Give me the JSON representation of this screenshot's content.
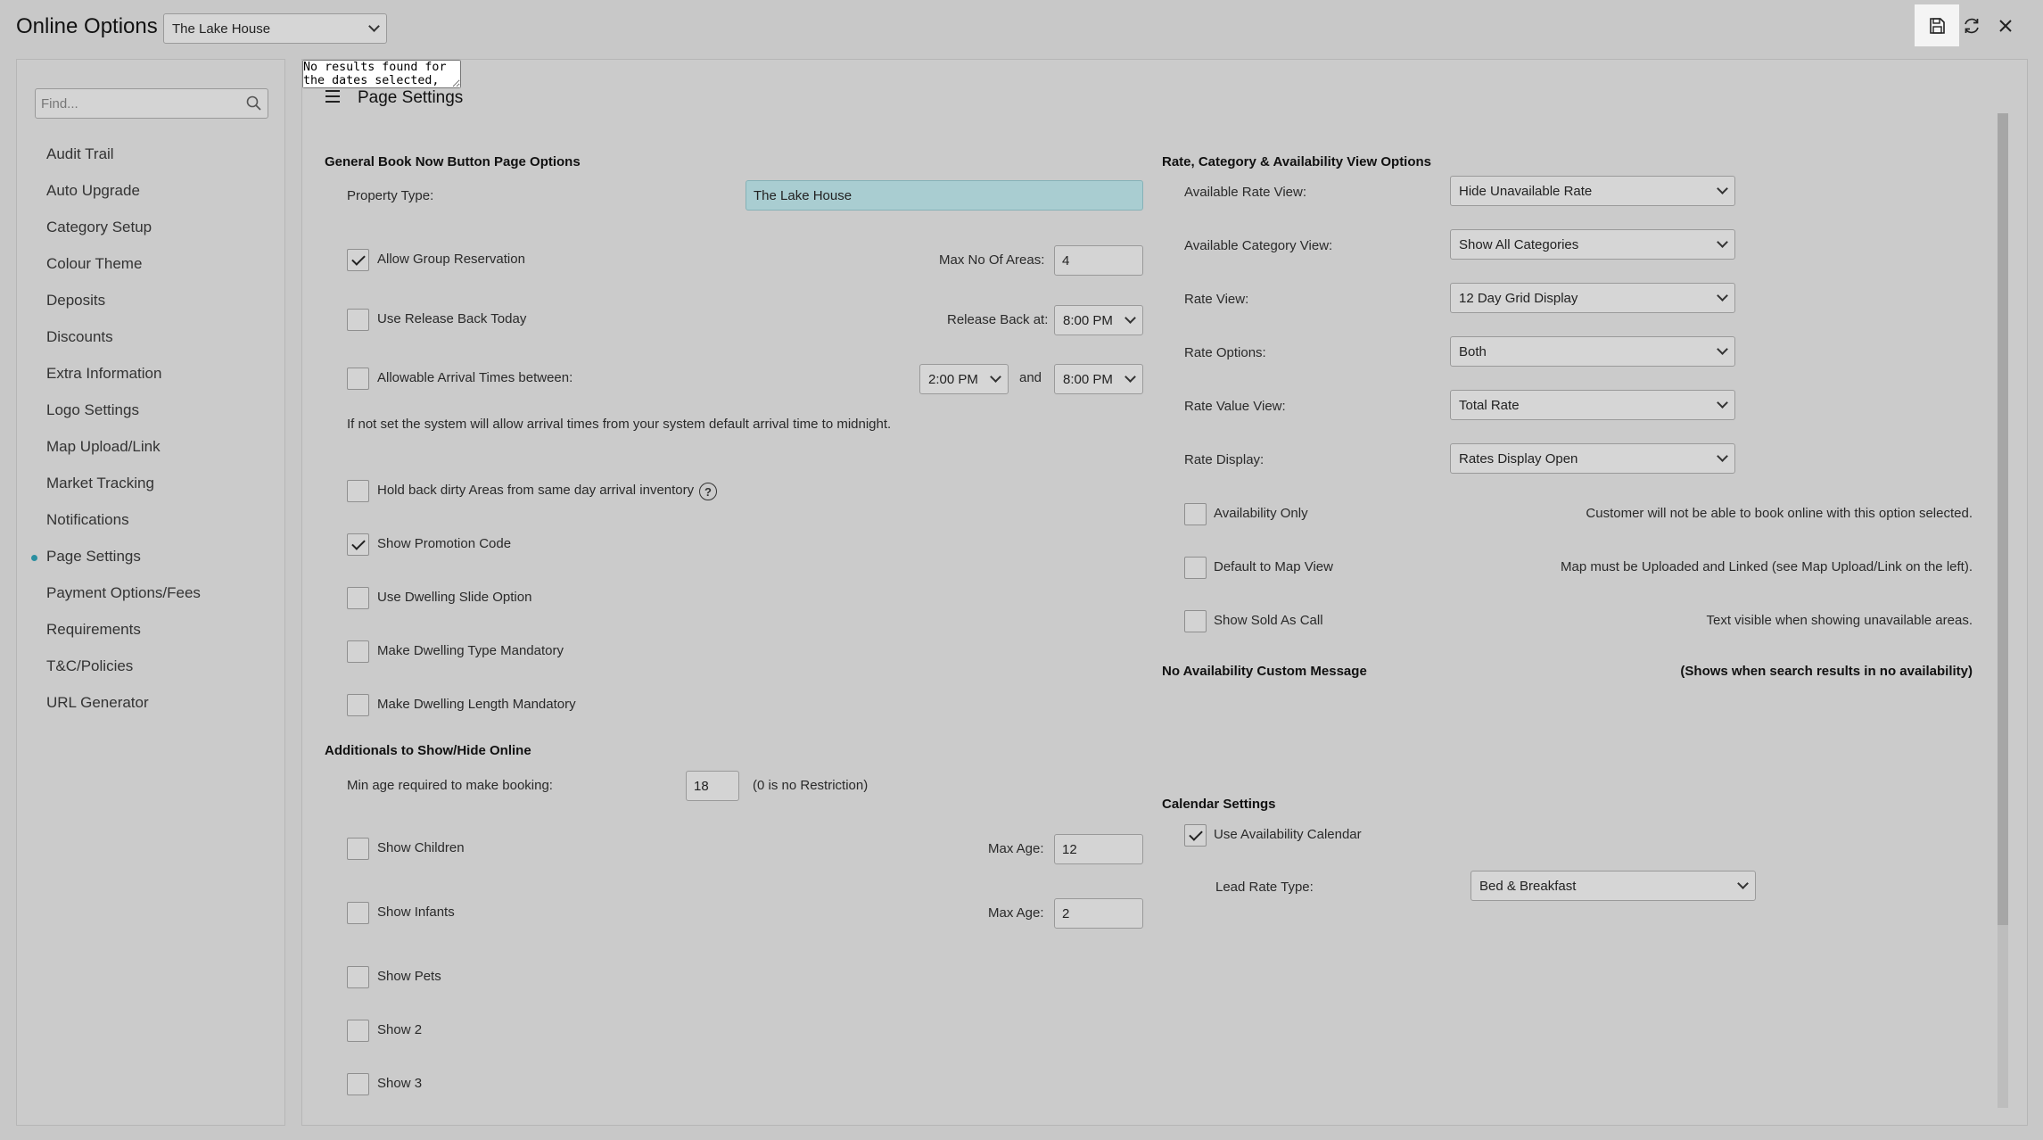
{
  "app": {
    "title": "Online Options",
    "property_select": "The Lake House"
  },
  "icons": {
    "save": "save-icon",
    "refresh": "refresh-icon",
    "close": "close-icon",
    "search": "search-icon",
    "menu": "menu-icon",
    "help": "help-icon"
  },
  "sidebar": {
    "find_placeholder": "Find...",
    "active_index": 11,
    "items": [
      {
        "label": "Audit Trail"
      },
      {
        "label": "Auto Upgrade"
      },
      {
        "label": "Category Setup"
      },
      {
        "label": "Colour Theme"
      },
      {
        "label": "Deposits"
      },
      {
        "label": "Discounts"
      },
      {
        "label": "Extra Information"
      },
      {
        "label": "Logo Settings"
      },
      {
        "label": "Map Upload/Link"
      },
      {
        "label": "Market Tracking"
      },
      {
        "label": "Notifications"
      },
      {
        "label": "Page Settings"
      },
      {
        "label": "Payment Options/Fees"
      },
      {
        "label": "Requirements"
      },
      {
        "label": "T&C/Policies"
      },
      {
        "label": "URL Generator"
      }
    ]
  },
  "page": {
    "title": "Page Settings",
    "general": {
      "heading": "General Book Now Button Page Options",
      "property_type_label": "Property Type:",
      "property_type_value": "The Lake House",
      "allow_group_label": "Allow Group Reservation",
      "allow_group_checked": true,
      "max_areas_label": "Max No Of Areas:",
      "max_areas_value": "4",
      "release_back_label": "Use Release Back Today",
      "release_back_checked": false,
      "release_back_at_label": "Release Back at:",
      "release_back_at_value": "8:00 PM",
      "arrival_label": "Allowable Arrival Times between:",
      "arrival_checked": false,
      "arrival_from": "2:00 PM",
      "arrival_and": "and",
      "arrival_to": "8:00 PM",
      "arrival_note": "If not set the system will allow arrival times from your system default arrival time to midnight.",
      "hold_back_label": "Hold back dirty Areas from same day arrival inventory",
      "hold_back_checked": false,
      "help_glyph": "?",
      "promo_label": "Show Promotion Code",
      "promo_checked": true,
      "dwelling_slide_label": "Use Dwelling Slide Option",
      "dwelling_slide_checked": false,
      "dwelling_type_label": "Make Dwelling Type Mandatory",
      "dwelling_type_checked": false,
      "dwelling_length_label": "Make Dwelling Length Mandatory",
      "dwelling_length_checked": false
    },
    "additionals": {
      "heading": "Additionals to Show/Hide Online",
      "min_age_label": "Min age required to make booking:",
      "min_age_value": "18",
      "min_age_note": "(0 is no Restriction)",
      "children_label": "Show Children",
      "children_checked": false,
      "children_max_age_label": "Max Age:",
      "children_max_age": "12",
      "infants_label": "Show Infants",
      "infants_checked": false,
      "infants_max_age_label": "Max Age:",
      "infants_max_age": "2",
      "pets_label": "Show Pets",
      "pets_checked": false,
      "show2_label": "Show 2",
      "show2_checked": false,
      "show3_label": "Show 3",
      "show3_checked": false
    },
    "rate_view": {
      "heading": "Rate, Category & Availability View Options",
      "available_rate_label": "Available Rate View:",
      "available_rate_value": "Hide Unavailable Rate",
      "available_category_label": "Available Category View:",
      "available_category_value": "Show All Categories",
      "rate_view_label": "Rate View:",
      "rate_view_value": "12 Day Grid Display",
      "rate_options_label": "Rate Options:",
      "rate_options_value": "Both",
      "rate_value_view_label": "Rate Value View:",
      "rate_value_view_value": "Total Rate",
      "rate_display_label": "Rate Display:",
      "rate_display_value": "Rates Display Open",
      "availability_only_label": "Availability Only",
      "availability_only_checked": false,
      "availability_only_note": "Customer will not be able to book online with this option selected.",
      "default_map_label": "Default to Map View",
      "default_map_checked": false,
      "default_map_note": "Map must be Uploaded and Linked (see Map Upload/Link on the left).",
      "sold_as_call_label": "Show Sold As Call",
      "sold_as_call_checked": false,
      "sold_as_call_note": "Text visible when showing unavailable areas."
    },
    "no_availability": {
      "heading": "No Availability Custom Message",
      "note": "(Shows when search results in no availability)",
      "message": "No results found for the dates selected, select another date or call reservations for assistance with your booking."
    },
    "calendar": {
      "heading": "Calendar Settings",
      "use_calendar_label": "Use Availability Calendar",
      "use_calendar_checked": true,
      "lead_rate_label": "Lead Rate Type:",
      "lead_rate_value": "Bed & Breakfast"
    }
  },
  "colors": {
    "background": "#c8c8c8",
    "panel": "#cbcbcb",
    "property_type_field": "#a9cdd1",
    "active_dot": "#2a8fa0",
    "save_button_bg": "#f4f4f4"
  }
}
